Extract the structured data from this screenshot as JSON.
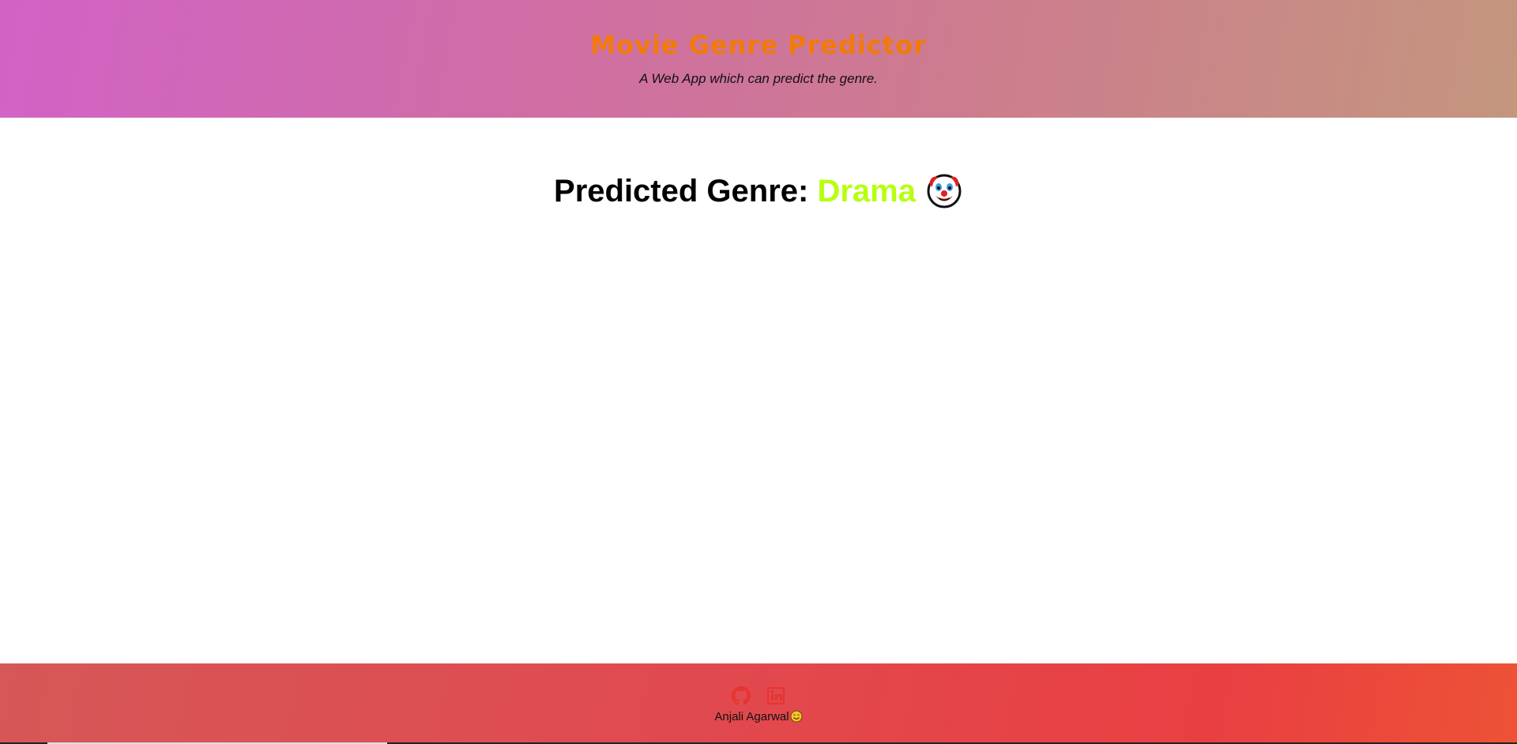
{
  "header": {
    "title": "Movie Genre Predictor",
    "subtitle": "A Web App which can predict the genre."
  },
  "result": {
    "label": "Predicted Genre: ",
    "genre": "Drama",
    "icon": "clown-face-icon"
  },
  "footer": {
    "links": [
      {
        "icon": "github-icon"
      },
      {
        "icon": "linkedin-icon"
      }
    ],
    "author": "Anjali Agarwal",
    "author_icon": "smiling-face-icon"
  },
  "colors": {
    "title": "#f27a0a",
    "genre": "#b7ff0f",
    "footer_icons": "#e8332f"
  }
}
